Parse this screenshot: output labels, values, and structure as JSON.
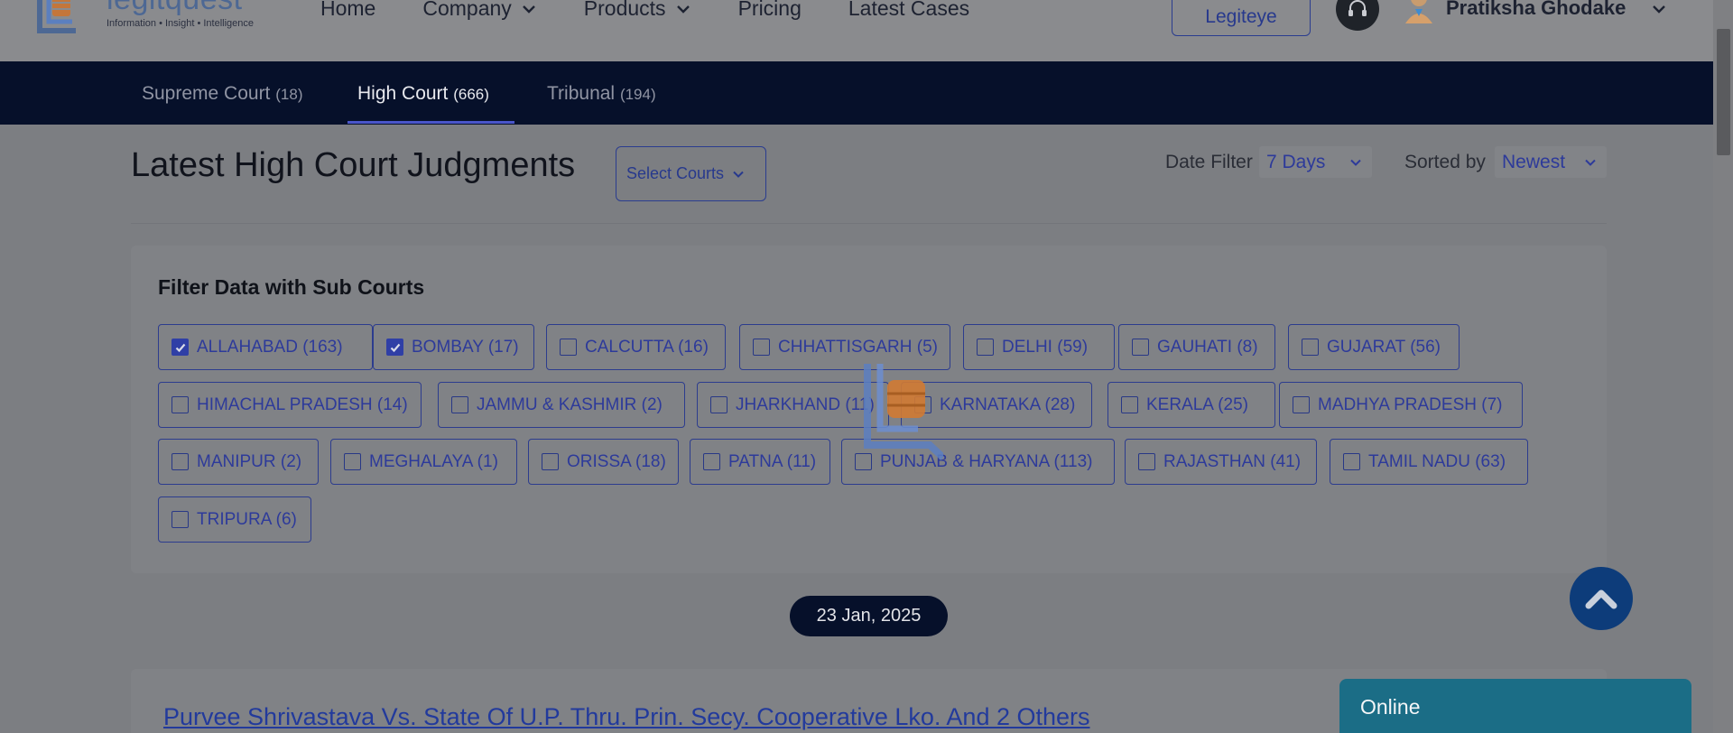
{
  "header": {
    "logo_text": "legitquest",
    "logo_tagline": "Information • Insight • Intelligence",
    "nav": [
      {
        "label": "Home",
        "has_dropdown": false
      },
      {
        "label": "Company",
        "has_dropdown": true
      },
      {
        "label": "Products",
        "has_dropdown": true
      },
      {
        "label": "Pricing",
        "has_dropdown": false
      },
      {
        "label": "Latest Cases",
        "has_dropdown": false
      }
    ],
    "legiteye_label": "Legiteye",
    "user_name": "Pratiksha Ghodake"
  },
  "court_tabs": [
    {
      "name": "Supreme Court",
      "count": "(18)",
      "active": false
    },
    {
      "name": "High Court",
      "count": "(666)",
      "active": true
    },
    {
      "name": "Tribunal",
      "count": "(194)",
      "active": false
    }
  ],
  "page": {
    "title": "Latest High Court Judgments",
    "select_courts_label": "Select Courts",
    "date_filter_label": "Date Filter",
    "date_filter_value": "7 Days",
    "sorted_by_label": "Sorted by",
    "sorted_by_value": "Newest"
  },
  "sub_courts": {
    "title": "Filter Data with Sub Courts",
    "items": [
      {
        "label": "ALLAHABAD (163)",
        "checked": true
      },
      {
        "label": "BOMBAY (17)",
        "checked": true
      },
      {
        "label": "CALCUTTA (16)",
        "checked": false
      },
      {
        "label": "CHHATTISGARH (5)",
        "checked": false
      },
      {
        "label": "DELHI (59)",
        "checked": false
      },
      {
        "label": "GAUHATI (8)",
        "checked": false
      },
      {
        "label": "GUJARAT (56)",
        "checked": false
      },
      {
        "label": "HIMACHAL PRADESH (14)",
        "checked": false
      },
      {
        "label": "JAMMU & KASHMIR (2)",
        "checked": false
      },
      {
        "label": "JHARKHAND (11)",
        "checked": false
      },
      {
        "label": "KARNATAKA (28)",
        "checked": false
      },
      {
        "label": "KERALA (25)",
        "checked": false
      },
      {
        "label": "MADHYA PRADESH (7)",
        "checked": false
      },
      {
        "label": "MANIPUR (2)",
        "checked": false
      },
      {
        "label": "MEGHALAYA (1)",
        "checked": false
      },
      {
        "label": "ORISSA (18)",
        "checked": false
      },
      {
        "label": "PATNA (11)",
        "checked": false
      },
      {
        "label": "PUNJAB & HARYANA (113)",
        "checked": false
      },
      {
        "label": "RAJASTHAN (41)",
        "checked": false
      },
      {
        "label": "TAMIL NADU (63)",
        "checked": false
      },
      {
        "label": "TRIPURA (6)",
        "checked": false
      }
    ]
  },
  "results": {
    "date": "23 Jan, 2025",
    "first_case_title": "Purvee Shrivastava Vs. State Of U.P. Thru. Prin. Secy. Cooperative Lko. And 2 Others"
  },
  "chat": {
    "status": "Online"
  },
  "colors": {
    "navy": "#06102a",
    "accent_blue": "#2d3a9a",
    "chat_teal": "#1b6d86",
    "scroll_top_blue": "#0d3c7a"
  }
}
